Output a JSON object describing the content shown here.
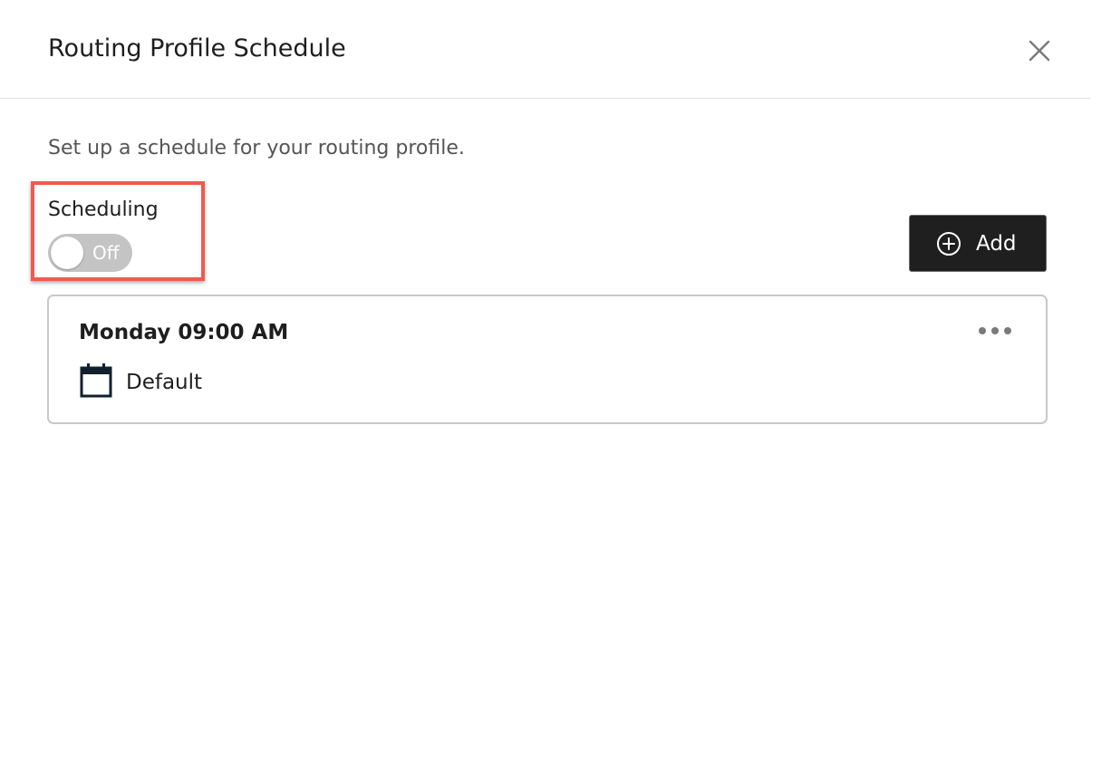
{
  "dialog": {
    "title": "Routing Profile Schedule",
    "close_icon": "close-icon",
    "description": "Set up a schedule for your routing profile."
  },
  "scheduling": {
    "label": "Scheduling",
    "toggle_state": "Off",
    "toggle_on": false,
    "highlight_color": "#f05a4f"
  },
  "toolbar": {
    "add_label": "Add",
    "add_icon": "plus-circle-icon"
  },
  "schedules": [
    {
      "time": "Monday 09:00 AM",
      "schedule_name": "Default",
      "icon": "calendar-icon",
      "menu_icon": "more-horizontal-icon"
    }
  ],
  "colors": {
    "primary_button": "#1f1f1f",
    "toggle_off": "#c4c4c4",
    "card_border": "#c8c8c8"
  }
}
